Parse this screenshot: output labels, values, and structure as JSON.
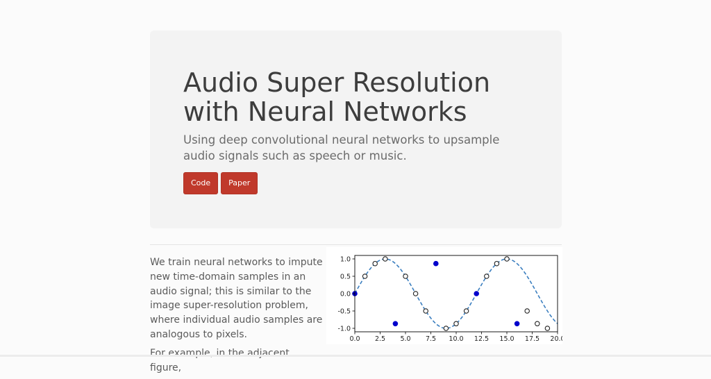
{
  "header": {
    "title": "Audio Super Resolution with Neural Networks",
    "subtitle": "Using deep convolutional neural networks to upsample audio signals such as speech or music.",
    "buttons": [
      {
        "label": "Code"
      },
      {
        "label": "Paper"
      }
    ],
    "button_color": "#c0392b"
  },
  "main": {
    "paragraphs": [
      "We train neural networks to impute new time-domain samples in an audio signal; this is similar to the image super-resolution problem, where individual audio samples are analogous to pixels.",
      "For example, in the adjacent figure,"
    ]
  },
  "chart_data": {
    "type": "line",
    "title": "",
    "xlabel": "",
    "ylabel": "",
    "xlim": [
      0,
      20
    ],
    "ylim": [
      -1.1,
      1.1
    ],
    "x_ticks": [
      "0.0",
      "2.5",
      "5.0",
      "7.5",
      "10.0",
      "12.5",
      "15.0",
      "17.5",
      "20.0"
    ],
    "y_ticks": [
      "1.0",
      "0.5",
      "0.0",
      "-0.5",
      "-1.0"
    ],
    "grid": false,
    "series": [
      {
        "style": "dashed-line",
        "color": "#3a7ebf",
        "function": "sin(pi*x/6)",
        "x_start": 0,
        "x_end": 20
      },
      {
        "style": "filled-markers",
        "color": "#0000cc",
        "x": [
          0,
          4,
          8,
          12,
          16
        ],
        "y": [
          0.0,
          -0.866,
          0.866,
          0.0,
          -0.866
        ]
      },
      {
        "style": "hollow-markers",
        "color": "#222222",
        "x": [
          1,
          2,
          3,
          5,
          6,
          7,
          9,
          10,
          11,
          13,
          14,
          15,
          17,
          18,
          19
        ],
        "y": [
          0.5,
          0.866,
          1.0,
          0.5,
          0.0,
          -0.5,
          -1.0,
          -0.866,
          -0.5,
          0.5,
          0.866,
          1.0,
          -0.5,
          -0.866,
          -1.0
        ]
      }
    ]
  }
}
